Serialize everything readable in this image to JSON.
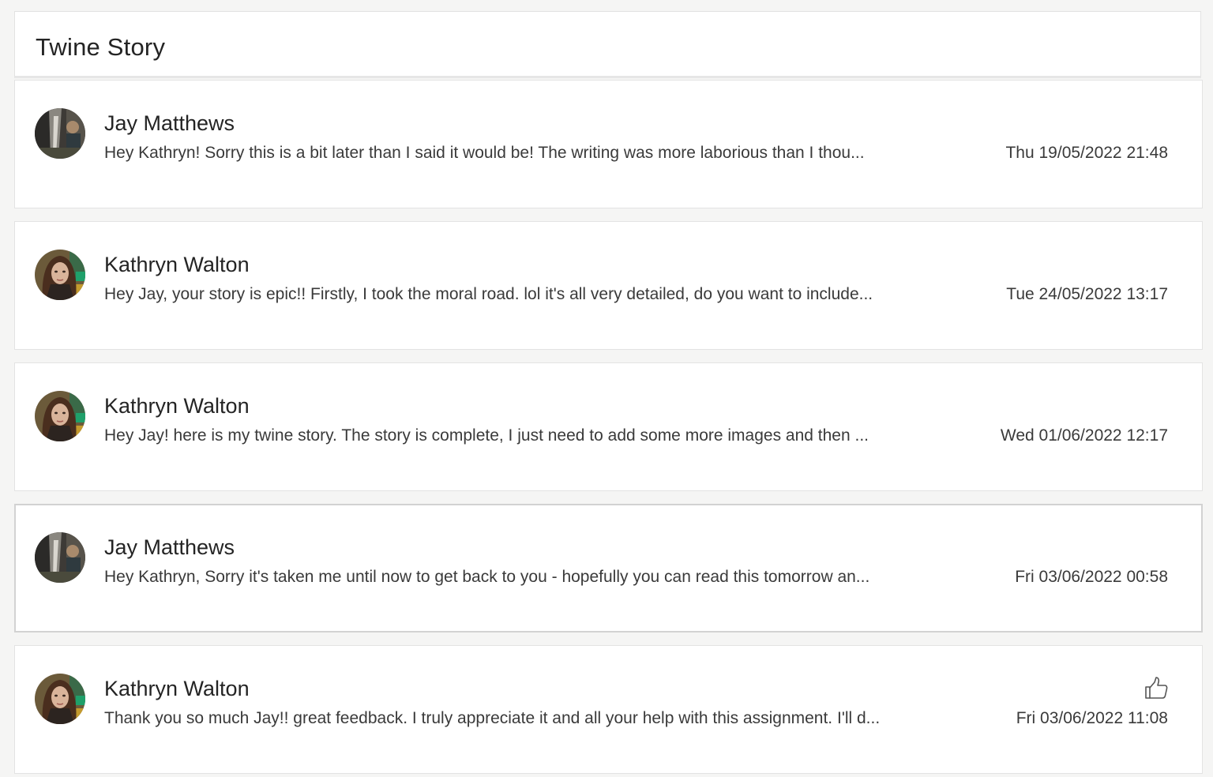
{
  "header": {
    "title": "Twine Story"
  },
  "messages": [
    {
      "sender": "Jay Matthews",
      "avatar_icon": "avatar-jay-matthews",
      "preview": "Hey Kathryn! Sorry this is a bit later than I said it would be! The writing was more laborious than I thou...",
      "timestamp": "Thu 19/05/2022 21:48",
      "selected": false,
      "liked": false
    },
    {
      "sender": "Kathryn Walton",
      "avatar_icon": "avatar-kathryn-walton",
      "preview": "Hey Jay, your story is epic!! Firstly, I took the moral road. lol it's all very detailed, do you want to include...",
      "timestamp": "Tue 24/05/2022 13:17",
      "selected": false,
      "liked": false
    },
    {
      "sender": "Kathryn Walton",
      "avatar_icon": "avatar-kathryn-walton",
      "preview": "Hey Jay! here is my twine story. The story is complete, I just need to add some more images and then ...",
      "timestamp": "Wed 01/06/2022 12:17",
      "selected": false,
      "liked": false
    },
    {
      "sender": "Jay Matthews",
      "avatar_icon": "avatar-jay-matthews",
      "preview": "Hey Kathryn, Sorry it's taken me until now to get back to you - hopefully you can read this tomorrow an...",
      "timestamp": "Fri 03/06/2022 00:58",
      "selected": true,
      "liked": false
    },
    {
      "sender": "Kathryn Walton",
      "avatar_icon": "avatar-kathryn-walton",
      "preview": "Thank you so much Jay!! great feedback. I truly appreciate it and all your help with this assignment. I'll d...",
      "timestamp": "Fri 03/06/2022 11:08",
      "selected": false,
      "liked": true,
      "like_icon": "thumbs-up-icon"
    }
  ],
  "colors": {
    "page_background": "#f5f5f4",
    "card_background": "#ffffff",
    "card_border": "#e3e3e3",
    "text_primary": "#242424",
    "text_secondary": "#3a3a3a"
  }
}
